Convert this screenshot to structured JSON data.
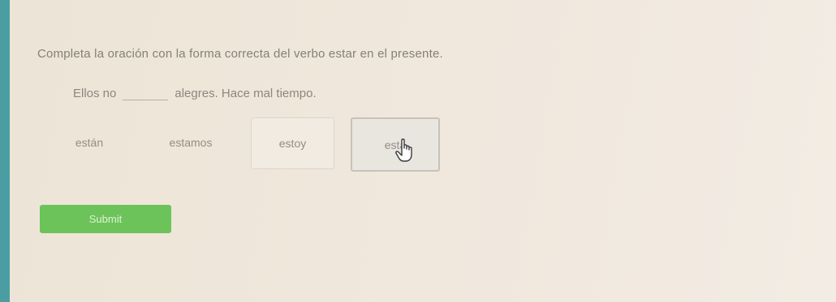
{
  "question": {
    "prompt": "Completa la oración con la forma correcta del verbo estar en el presente.",
    "sentence_before": "Ellos no",
    "sentence_after": "alegres. Hace mal tiempo."
  },
  "options": [
    {
      "label": "están"
    },
    {
      "label": "estamos"
    },
    {
      "label": "estoy"
    },
    {
      "label": "está",
      "selected": true
    }
  ],
  "submit_label": "Submit",
  "colors": {
    "accent_bar": "#4a9ea2",
    "submit_bg": "#6cc35a"
  },
  "icons": {
    "cursor": "hand-pointer-icon"
  }
}
